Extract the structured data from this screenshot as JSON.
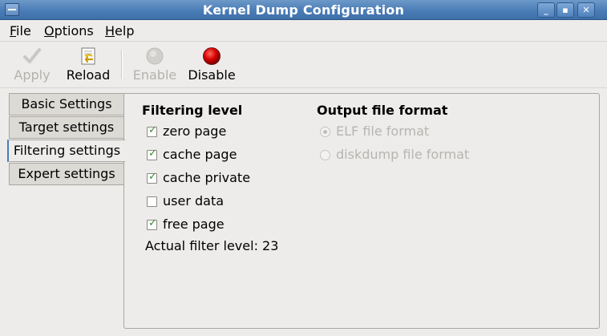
{
  "window": {
    "title": "Kernel Dump Configuration"
  },
  "menubar": {
    "items": [
      {
        "label_mnemonic": "F",
        "label_rest": "ile"
      },
      {
        "label_mnemonic": "O",
        "label_rest": "ptions"
      },
      {
        "label_mnemonic": "H",
        "label_rest": "elp"
      }
    ]
  },
  "toolbar": {
    "apply": {
      "label": "Apply",
      "icon": "checkmark-icon",
      "enabled": false
    },
    "reload": {
      "label": "Reload",
      "icon": "reload-document-icon",
      "enabled": true
    },
    "enable": {
      "label": "Enable",
      "icon": "gray-circle-icon",
      "enabled": false
    },
    "disable": {
      "label": "Disable",
      "icon": "red-circle-icon",
      "enabled": true
    }
  },
  "tabs": [
    {
      "label": "Basic Settings",
      "active": false
    },
    {
      "label": "Target settings",
      "active": false
    },
    {
      "label": "Filtering settings",
      "active": true
    },
    {
      "label": "Expert settings",
      "active": false
    }
  ],
  "filtering": {
    "title": "Filtering level",
    "options": [
      {
        "label": "zero page",
        "checked": true
      },
      {
        "label": "cache page",
        "checked": true
      },
      {
        "label": "cache private",
        "checked": true
      },
      {
        "label": "user data",
        "checked": false
      },
      {
        "label": "free page",
        "checked": true
      }
    ],
    "actual_level": "Actual filter level: 23"
  },
  "output": {
    "title": "Output file format",
    "options": [
      {
        "label": "ELF file format",
        "selected": true,
        "enabled": false
      },
      {
        "label": "diskdump file format",
        "selected": false,
        "enabled": false
      }
    ]
  },
  "colors": {
    "titlebar": "#4a7cb6",
    "checkmark": "#3c8a2e",
    "disabled_text": "#b4b2ae",
    "disable_icon": "#d40000"
  }
}
